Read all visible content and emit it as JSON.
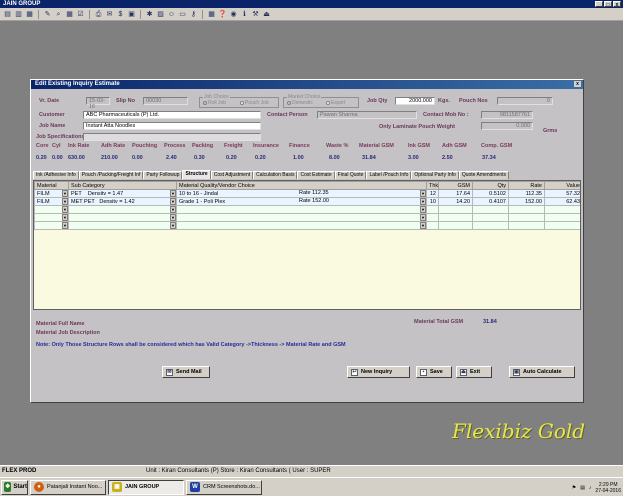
{
  "window": {
    "title": "JAIN GROUP",
    "controls": [
      "_",
      "□",
      "x"
    ]
  },
  "dialog": {
    "title": "Edit Existing Inquiry Estimate",
    "close": "x",
    "vr_date_label": "Vr. Date",
    "vr_date": "15-03-16",
    "slip_no_label": "Slip No",
    "slip_no": "00030",
    "job_choice_label": "Job Choice",
    "job_choice_opts": [
      "Roll Job",
      "Pouch Job"
    ],
    "market_choice_label": "Market Choice",
    "market_choice_opts": [
      "Domestic",
      "Export"
    ],
    "job_qty_label": "Job Qty",
    "job_qty": "2000.000",
    "job_qty_unit": "Kgs.",
    "pouch_nos_label": "Pouch Nos",
    "pouch_nos": "0",
    "customer_label": "Customer",
    "customer": "ABC Pharmaceuticals (P) Ltd.",
    "contact_person_label": "Contact Person",
    "contact_person": "Pawan Sharma",
    "contact_mob_label": "Contact Mob No :",
    "contact_mob": "9811587761",
    "job_name_label": "Job Name",
    "job_name": "Instant Atta Noodles",
    "only_lam_label": "Only Laminate Pouch Weight",
    "only_lam": "0.000",
    "grms": "Grms",
    "job_spec_label": "Job Specifications",
    "cost_headers": [
      "Core",
      "Cyl",
      "Ink Rate",
      "Adh Rate",
      "Pouching",
      "Process",
      "Packing",
      "Freight",
      "Insurance",
      "Finance",
      "Waste %",
      "Material GSM",
      "Ink GSM",
      "Adh GSM",
      "Comp. GSM"
    ],
    "cost_values": [
      "0.20",
      "0.00",
      "630.00",
      "210.00",
      "0.00",
      "2.40",
      "0.30",
      "0.20",
      "0.20",
      "1.00",
      "8.00",
      "31.84",
      "3.00",
      "2.50",
      "37.34"
    ],
    "tabs": [
      "Ink /Adhesive Info",
      "Pouch /Packing/Freight Inf",
      "Party Followup",
      "Structure",
      "Cost Adjustment",
      "Calculation Basis",
      "Cost Estimate",
      "Final Quote",
      "Label /Pouch Info",
      "Optional Party Info",
      "Quote Amendments"
    ],
    "active_tab": "Structure",
    "grid_headers": [
      "Material",
      "Sub Category",
      "Material Quality/Vendor Choice",
      "Thk",
      "GSM",
      "Qty",
      "Rate",
      "Value"
    ],
    "grid_rows": [
      {
        "material": "FILM",
        "sub": "PET",
        "density": "Densitv = 1.47",
        "quality": "10 to 16 - Jindal",
        "rate_lbl": "Rate 112.35",
        "thk": "12",
        "gsm": "17.64",
        "qty": "0.5102",
        "rate": "112.35",
        "value": "57.32"
      },
      {
        "material": "FILM",
        "sub": "MET PET",
        "density": "Densitv = 1.42",
        "quality": "Grade 1 - Poli Plex",
        "rate_lbl": "Rate 152.00",
        "thk": "10",
        "gsm": "14.20",
        "qty": "0.4107",
        "rate": "152.00",
        "value": "62.43"
      }
    ],
    "material_full_name_label": "Material Full Name",
    "material_total_gsm_label": "Material Total GSM",
    "material_total_gsm": "31.84",
    "material_job_desc_label": "Material Job Description",
    "note": "Note: Only Those Structure Rows shall be considered which has Valid Category ->Thickness -> Material Rate and GSM",
    "buttons": {
      "send_mail": "Send Mail",
      "new_inquiry": "New Inquiry",
      "save": "Save",
      "exit": "Exit",
      "auto_calc": "Auto Calculate"
    }
  },
  "brand": "Flexibiz Gold",
  "status": {
    "left": "FLEX PROD",
    "middle": "Unit : Kiran Consultants (P) Store : Kiran Consultants ( User : SUPER"
  },
  "taskbar": {
    "start": "Start",
    "items": [
      "Patanjali Instant Noo...",
      "JAIN GROUP",
      "CRM Screenshots.do..."
    ],
    "time": "2:29 PM",
    "date": "27-04-2016"
  }
}
